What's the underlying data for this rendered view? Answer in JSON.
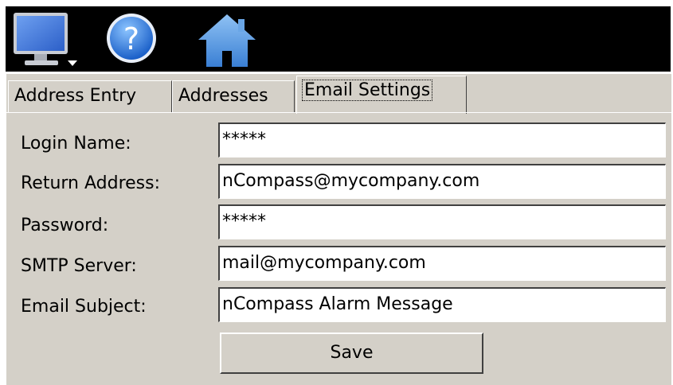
{
  "toolbar": {
    "icons": [
      "monitor-menu-icon",
      "help-icon",
      "home-icon"
    ]
  },
  "tabs": [
    {
      "label": "Address Entry",
      "active": false
    },
    {
      "label": "Addresses",
      "active": false
    },
    {
      "label": "Email Settings",
      "active": true
    }
  ],
  "form": {
    "login_name": {
      "label": "Login Name:",
      "value": "*****"
    },
    "return_address": {
      "label": "Return Address:",
      "value": "nCompass@mycompany.com"
    },
    "password": {
      "label": "Password:",
      "value": "*****"
    },
    "smtp_server": {
      "label": "SMTP Server:",
      "value": "mail@mycompany.com"
    },
    "email_subject": {
      "label": "Email Subject:",
      "value": "nCompass Alarm Message"
    }
  },
  "save_label": "Save",
  "colors": {
    "toolbar_bg": "#000000",
    "panel_bg": "#d4d0c8",
    "field_bg": "#ffffff",
    "monitor_blue": "#3b6fd8",
    "help_blue": "#2a7be0",
    "home_blue": "#5ea0e8"
  }
}
